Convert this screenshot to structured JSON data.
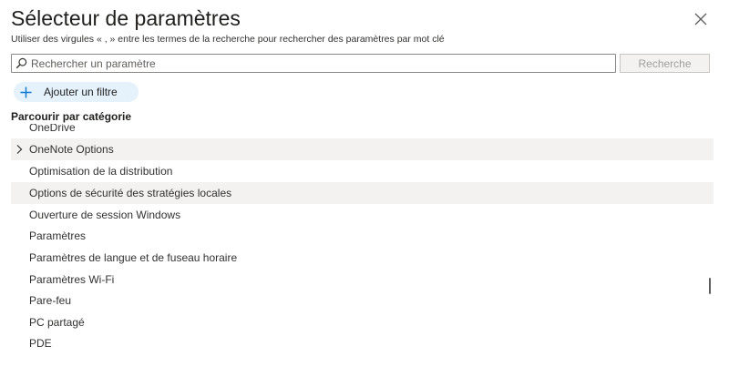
{
  "dialog": {
    "title": "Sélecteur de paramètres",
    "subtitle": "Utiliser des virgules « , » entre les termes de la recherche pour rechercher des paramètres par mot clé",
    "close_icon": "close-icon"
  },
  "search": {
    "placeholder": "Rechercher un paramètre",
    "value": "",
    "button_label": "Recherche",
    "icon": "search-icon"
  },
  "filter": {
    "add_label": "Ajouter un filtre",
    "icon": "plus-icon"
  },
  "browse": {
    "heading": "Parcourir par catégorie",
    "clipped_item": "OneDrive",
    "items": [
      {
        "label": "OneNote Options",
        "expandable": true
      },
      {
        "label": "Optimisation de la distribution",
        "expandable": false
      },
      {
        "label": "Options de sécurité des stratégies locales",
        "expandable": false,
        "highlighted": true
      },
      {
        "label": "Ouverture de session Windows",
        "expandable": false
      },
      {
        "label": "Paramètres",
        "expandable": false
      },
      {
        "label": "Paramètres de langue et de fuseau horaire",
        "expandable": false
      },
      {
        "label": "Paramètres Wi-Fi",
        "expandable": false
      },
      {
        "label": "Pare-feu",
        "expandable": false
      },
      {
        "label": "PC partagé",
        "expandable": false
      },
      {
        "label": "PDE",
        "expandable": false
      }
    ]
  },
  "colors": {
    "accent": "#0078d4",
    "highlight_fill": "#faf5a3",
    "highlight_border": "#e6e345",
    "row_hover": "#f3f2f1",
    "filter_chip": "#e5f1fb"
  }
}
